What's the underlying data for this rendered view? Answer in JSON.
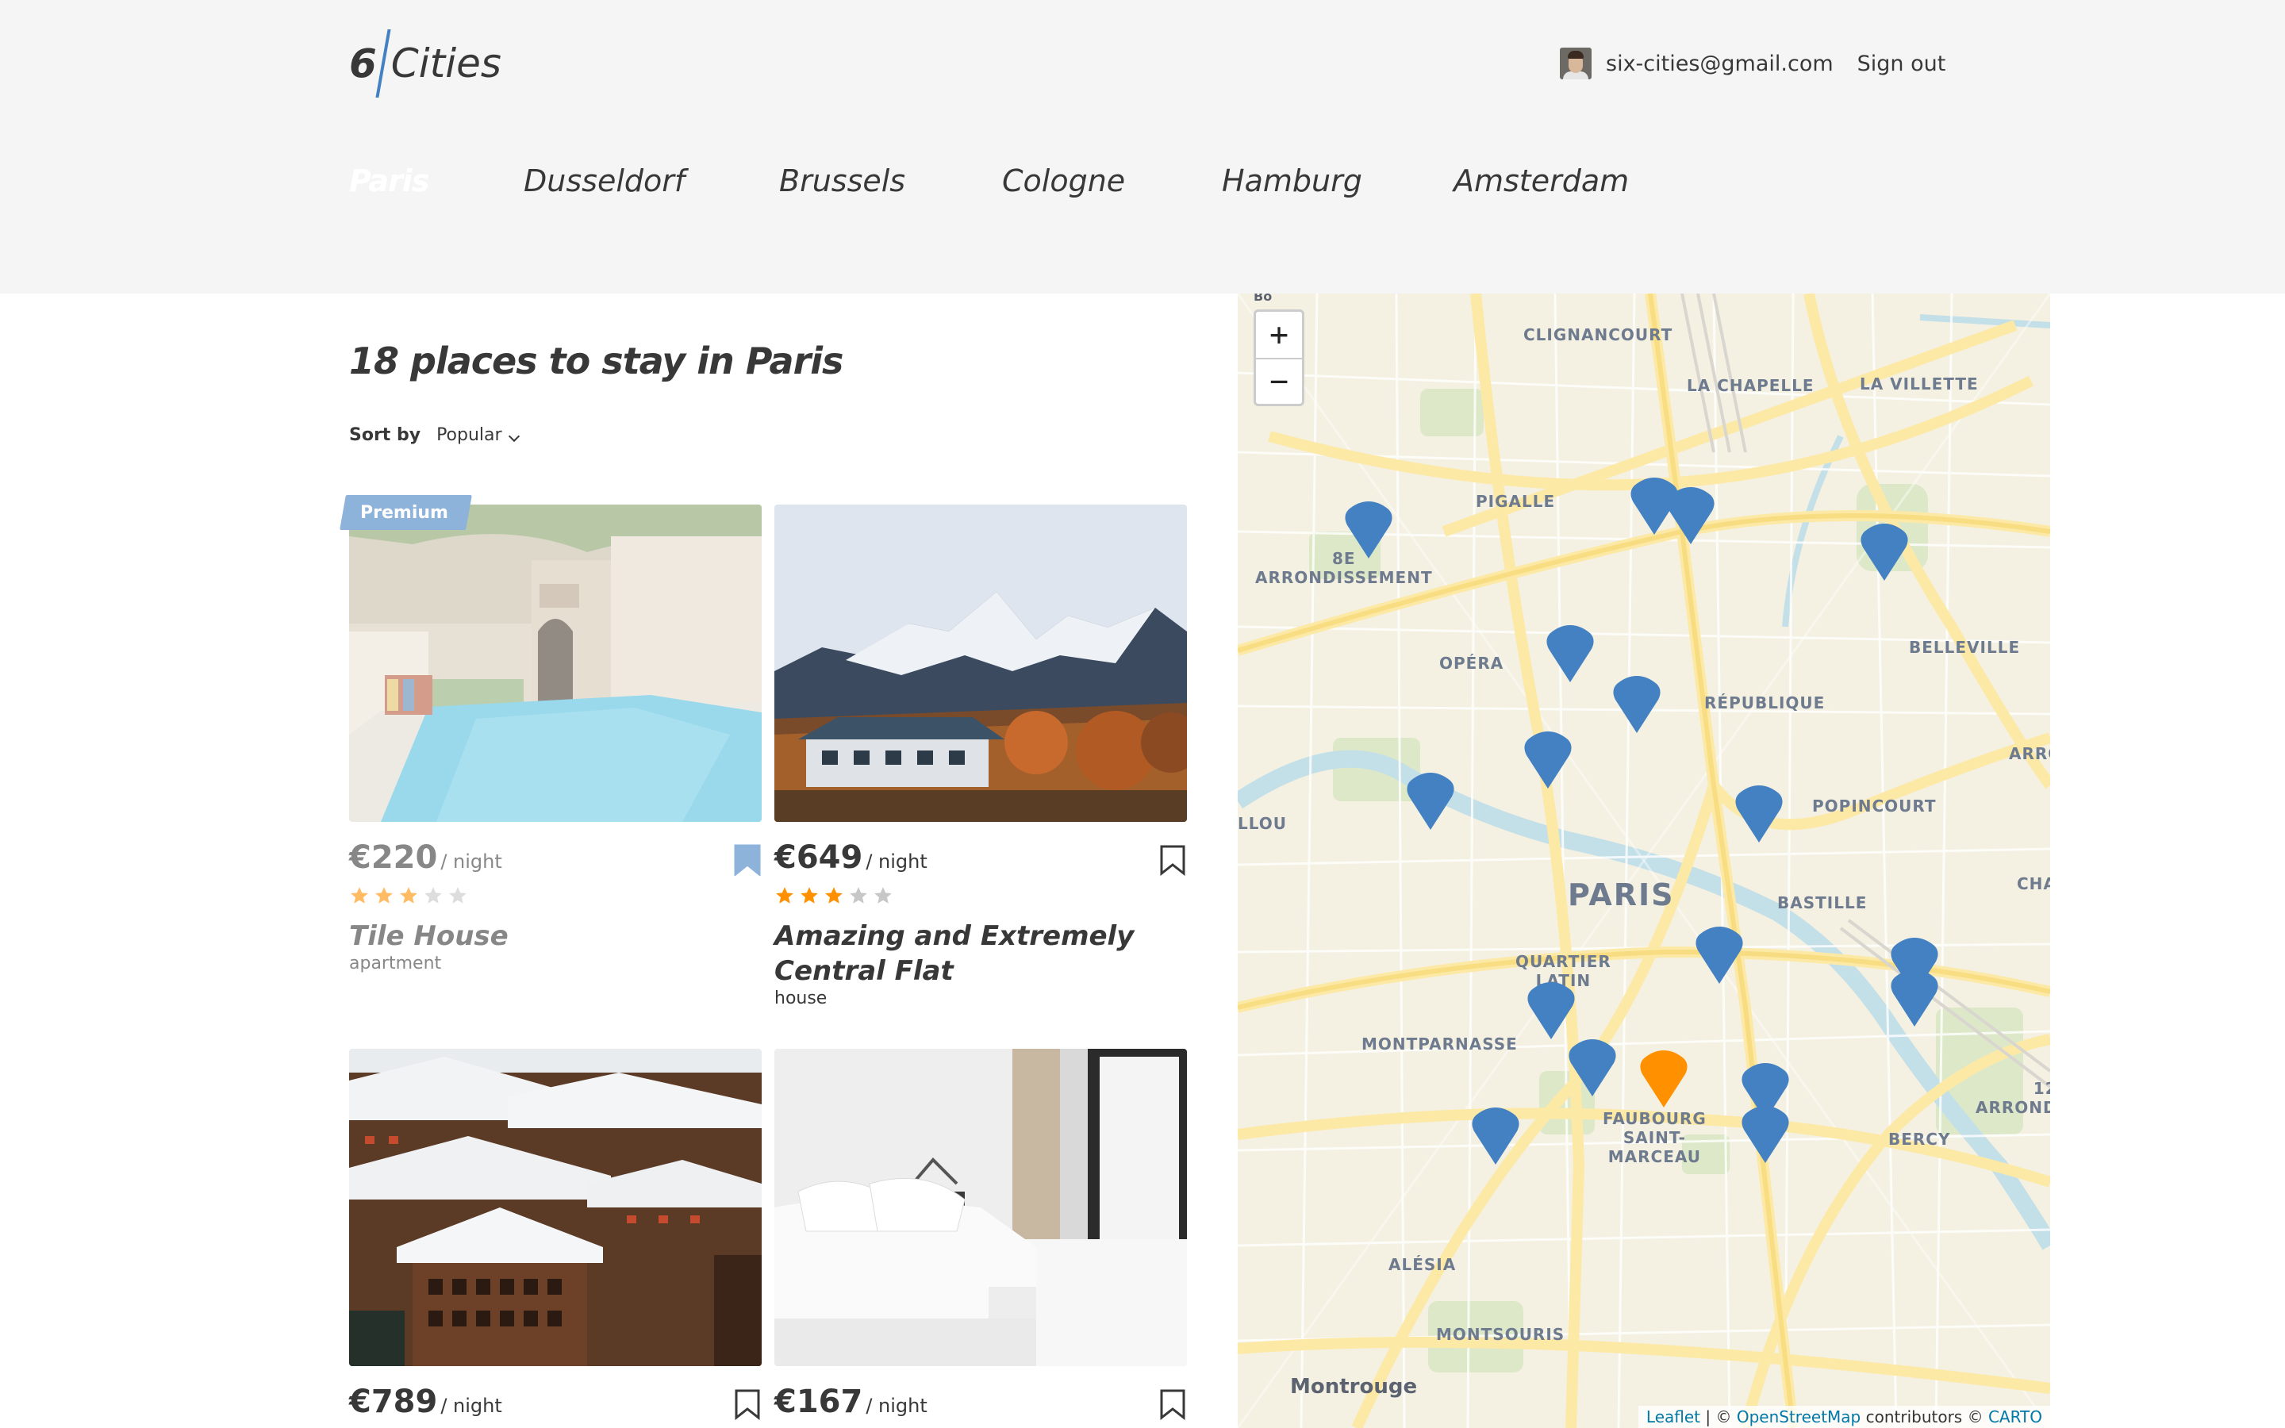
{
  "header": {
    "logo_number": "6",
    "logo_text": "Cities",
    "user_email": "six-cities@gmail.com",
    "signout_label": "Sign out"
  },
  "cities": [
    "Paris",
    "Dusseldorf",
    "Brussels",
    "Cologne",
    "Hamburg",
    "Amsterdam"
  ],
  "active_city": "Paris",
  "places_title": "18 places to stay in Paris",
  "sort": {
    "label": "Sort by",
    "value": "Popular"
  },
  "price_unit": "/ night",
  "cards": [
    {
      "premium": "Premium",
      "price": "€220",
      "rating": 3,
      "name": "Tile House",
      "type": "apartment",
      "bookmarked": true,
      "image": "pool"
    },
    {
      "premium": "",
      "price": "€649",
      "rating": 3,
      "name": "Amazing and Extremely Central Flat",
      "type": "house",
      "bookmarked": false,
      "image": "mountain-house"
    },
    {
      "premium": "",
      "price": "€789",
      "rating": null,
      "name": "",
      "type": "",
      "bookmarked": false,
      "image": "chalet"
    },
    {
      "premium": "",
      "price": "€167",
      "rating": null,
      "name": "",
      "type": "",
      "bookmarked": false,
      "image": "bedroom"
    }
  ],
  "map": {
    "labels": {
      "clignancourt": "CLIGNANCOURT",
      "la_chapelle": "LA CHAPELLE",
      "la_villette": "LA VILLETTE",
      "pigalle": "PIGALLE",
      "arrondissement_8": "8E\nARRONDISSEMENT",
      "opera": "OPÉRA",
      "belleville": "BELLEVILLE",
      "republique": "RÉPUBLIQUE",
      "arro": "ARRO",
      "llou": "LLOU",
      "popincourt": "POPINCOURT",
      "cha": "CHA",
      "paris": "PARIS",
      "bastille": "BASTILLE",
      "quartier_latin": "QUARTIER\nLATIN",
      "montparnasse": "MONTPARNASSE",
      "faubourg": "FAUBOURG\nSAINT-\nMARCEAU",
      "arrond_12": "12\nARROND",
      "bercy": "BERCY",
      "alesia": "ALÉSIA",
      "montsouris": "MONTSOURIS",
      "montrouge": "Montrouge",
      "bo": "Bo"
    },
    "zoom_in": "+",
    "zoom_out": "−",
    "attribution": {
      "leaflet": "Leaflet",
      "sep": " | © ",
      "osm": "OpenStreetMap",
      "contrib": " contributors © ",
      "carto": "CARTO"
    },
    "colors": {
      "pin": "#4481c3",
      "pin_active": "#ff9000",
      "road": "#fde9a6",
      "park": "#dde8c8",
      "water": "#c3dfe8"
    }
  },
  "colors": {
    "accent": "#4481c3",
    "star": "#ff9000",
    "star_empty": "#c7c7c7",
    "text": "#383838"
  }
}
